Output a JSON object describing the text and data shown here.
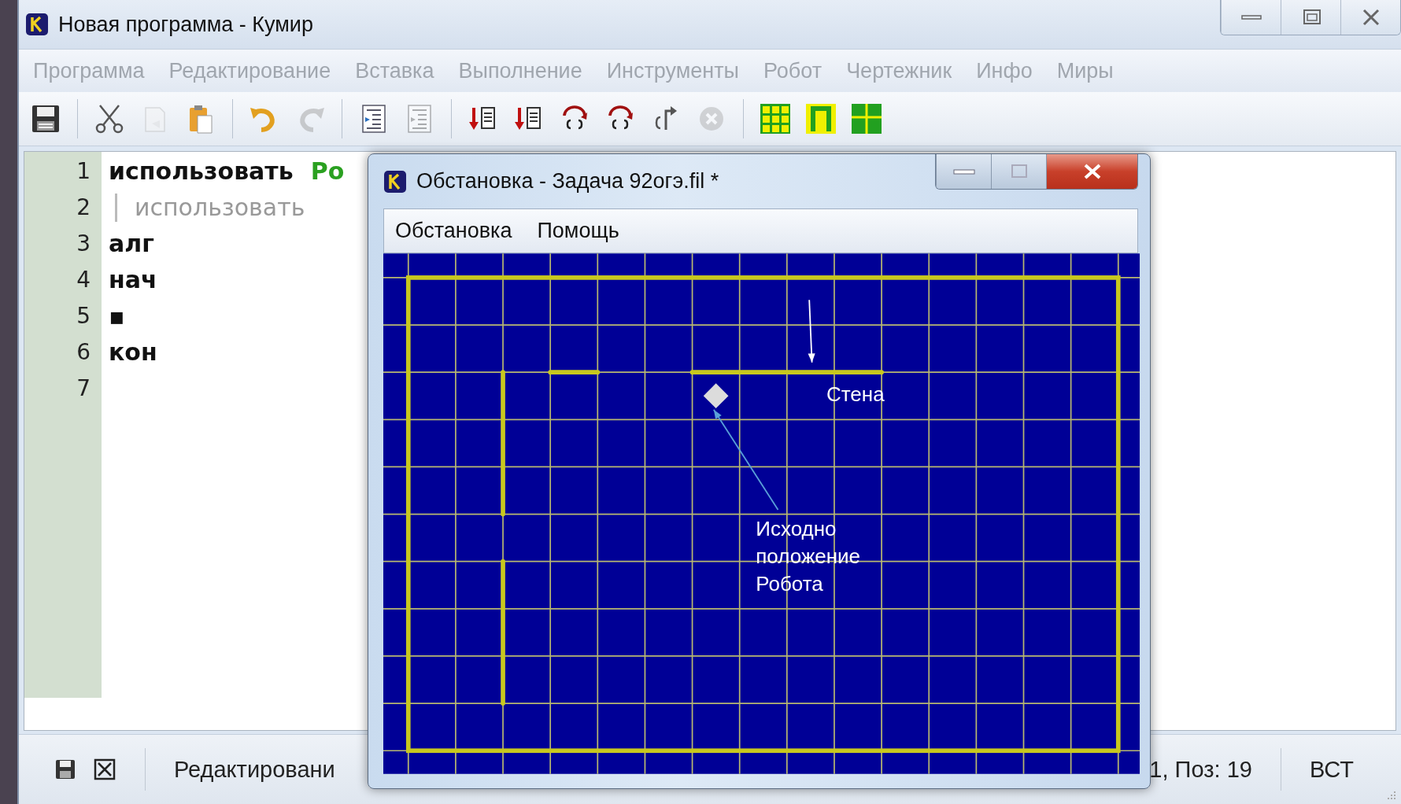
{
  "main_window": {
    "title": "Новая программа - Кумир",
    "menu": [
      {
        "label": "Программа",
        "disabled": true
      },
      {
        "label": "Редактирование",
        "disabled": true
      },
      {
        "label": "Вставка",
        "disabled": true
      },
      {
        "label": "Выполнение",
        "disabled": true
      },
      {
        "label": "Инструменты",
        "disabled": true
      },
      {
        "label": "Робот",
        "disabled": true
      },
      {
        "label": "Чертежник",
        "disabled": true
      },
      {
        "label": "Инфо",
        "disabled": true
      },
      {
        "label": "Миры",
        "disabled": true
      }
    ],
    "toolbar": [
      [
        {
          "kind": "save",
          "disabled": false
        }
      ],
      [
        {
          "kind": "cut",
          "disabled": false
        },
        {
          "kind": "copy",
          "disabled": true
        },
        {
          "kind": "paste",
          "disabled": false
        }
      ],
      [
        {
          "kind": "undo",
          "disabled": false
        },
        {
          "kind": "redo",
          "disabled": true
        }
      ],
      [
        {
          "kind": "indent",
          "disabled": false
        },
        {
          "kind": "unindent",
          "disabled": true
        }
      ],
      [
        {
          "kind": "run",
          "disabled": false
        },
        {
          "kind": "step",
          "disabled": false
        },
        {
          "kind": "step-over",
          "disabled": false
        },
        {
          "kind": "step-in",
          "disabled": false
        },
        {
          "kind": "step-out",
          "disabled": false
        },
        {
          "kind": "stop",
          "disabled": true
        }
      ],
      [
        {
          "kind": "grid",
          "disabled": false
        },
        {
          "kind": "frame",
          "disabled": false
        },
        {
          "kind": "cross",
          "disabled": false
        }
      ]
    ],
    "editor": {
      "lines": [
        {
          "number": "1",
          "indented": false,
          "tokens": [
            {
              "kind": "keyword",
              "text": "использовать"
            },
            {
              "kind": "module",
              "text": "Ро"
            }
          ]
        },
        {
          "number": "2",
          "indented": true,
          "tokens": [
            {
              "kind": "inactive",
              "text": "использовать"
            }
          ]
        },
        {
          "number": "3",
          "indented": false,
          "tokens": [
            {
              "kind": "keyword",
              "text": "алг"
            }
          ]
        },
        {
          "number": "4",
          "indented": false,
          "tokens": [
            {
              "kind": "keyword",
              "text": "нач"
            }
          ]
        },
        {
          "number": "5",
          "indented": false,
          "tokens": [
            {
              "kind": "keyword",
              "text": "▪"
            }
          ]
        },
        {
          "number": "6",
          "indented": false,
          "tokens": [
            {
              "kind": "keyword",
              "text": "кон"
            }
          ]
        },
        {
          "number": "7",
          "indented": false
        }
      ]
    },
    "status_bar": {
      "mode": "Редактировани",
      "position": "1, Поз: 19",
      "insert_mode": "ВСТ"
    }
  },
  "robot_window": {
    "title": "Обстановка - Задача 92огэ.fil *",
    "menu": [
      {
        "label": "Обстановка",
        "disabled": false
      },
      {
        "label": "Помощь",
        "disabled": false
      }
    ],
    "annotations": [
      {
        "kind": "wall",
        "text": "Стена"
      },
      {
        "kind": "start",
        "text": "Исходно положение Робота"
      }
    ]
  }
}
